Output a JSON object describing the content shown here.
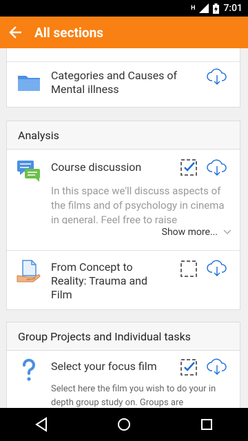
{
  "status_bar": {
    "network": "H",
    "time": "7:01"
  },
  "app_bar": {
    "title": "All sections",
    "back_icon": "arrow-left-icon"
  },
  "colors": {
    "accent": "#f98012",
    "link_blue": "#1c6fd6",
    "grey_text": "#9a9a9a"
  },
  "sections": [
    {
      "title": "",
      "modules": [
        {
          "title": "Categories and Causes of Mental illness",
          "icon": "folder-icon",
          "download_icon": "cloud-download-icon"
        }
      ]
    },
    {
      "title": "Analysis",
      "modules": [
        {
          "title": "Course discussion",
          "icon": "forum-icon",
          "completion": "checked",
          "download_icon": "cloud-download-icon",
          "description": "In this space we'll discuss aspects of the films and of psychology in cinema in general. Feel free to raise",
          "show_more": "Show more..."
        },
        {
          "title": "From Concept to Reality: Trauma and Film",
          "icon": "page-icon",
          "completion": "unchecked",
          "download_icon": "cloud-download-icon"
        }
      ]
    },
    {
      "title": "Group Projects and Individual tasks",
      "modules": [
        {
          "title": "Select your focus film",
          "icon": "question-icon",
          "completion": "checked",
          "download_icon": "cloud-download-icon",
          "description": "Select here the film you wish to do your in depth group study on. Groups are"
        }
      ]
    }
  ],
  "nav_bar": {
    "back": "nav-back-icon",
    "home": "nav-home-icon",
    "recents": "nav-recents-icon"
  }
}
